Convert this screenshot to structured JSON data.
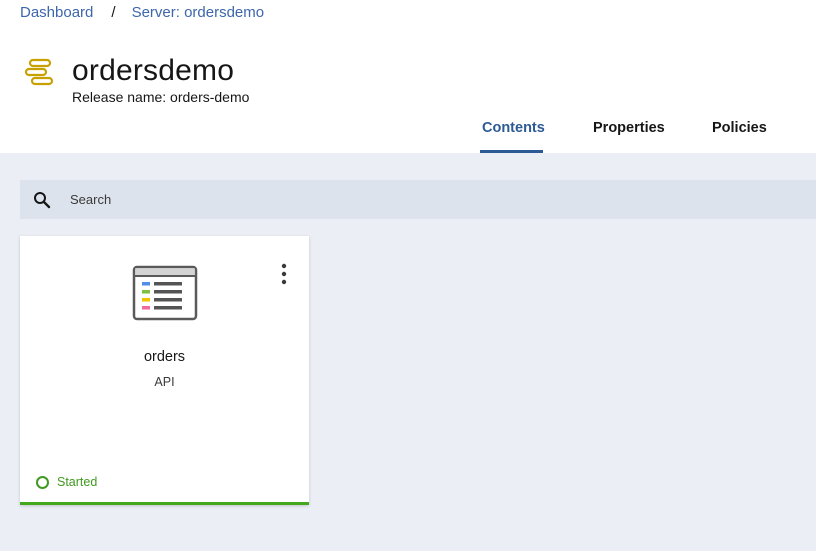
{
  "breadcrumb": {
    "items": [
      {
        "label": "Dashboard"
      },
      {
        "label": "Server: ordersdemo"
      }
    ],
    "separator": "/"
  },
  "header": {
    "title": "ordersdemo",
    "subtitle": "Release name: orders-demo",
    "icon": "server-icon",
    "icon_color": "#c8a100"
  },
  "tabs": [
    {
      "label": "Contents",
      "active": true
    },
    {
      "label": "Properties",
      "active": false
    },
    {
      "label": "Policies",
      "active": false
    }
  ],
  "search": {
    "placeholder": "Search",
    "value": ""
  },
  "cards": [
    {
      "name": "orders",
      "type": "API",
      "icon": "api-document-icon",
      "status": "Started",
      "status_color": "#3f9a1f"
    }
  ],
  "colors": {
    "accent": "#2d5a96",
    "link": "#3d66ab",
    "content_bg": "#ebeff5",
    "status_started": "#43a81c"
  }
}
